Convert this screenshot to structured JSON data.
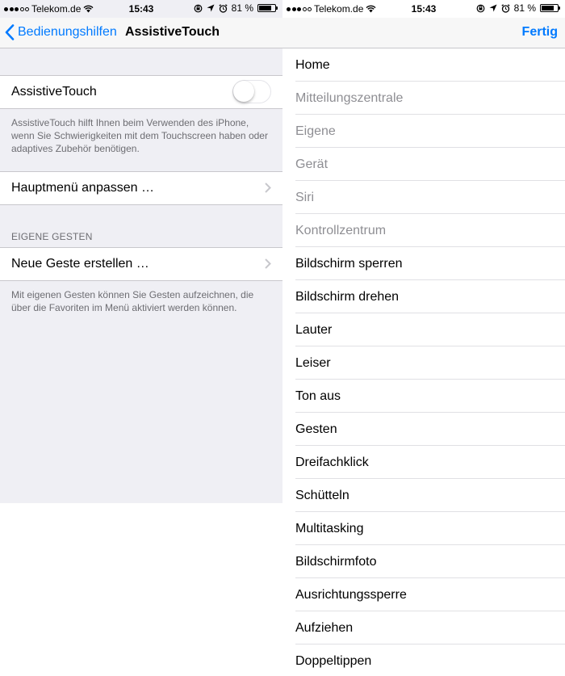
{
  "statusbar": {
    "carrier": "Telekom.de",
    "time": "15:43",
    "battery": "81 %",
    "battery_level": 0.81
  },
  "left": {
    "nav": {
      "back_label": "Bedienungshilfen",
      "title": "AssistiveTouch"
    },
    "assistive_touch": {
      "label": "AssistiveTouch",
      "enabled": false
    },
    "description": "AssistiveTouch hilft Ihnen beim Verwenden des iPhone, wenn Sie Schwierigkeiten mit dem Touchscreen haben oder adaptives Zubehör benötigen.",
    "customize_menu": "Hauptmenü anpassen …",
    "section_header": "EIGENE GESTEN",
    "new_gesture": "Neue Geste erstellen …",
    "gesture_footer": "Mit eigenen Gesten können Sie Gesten aufzeichnen, die über die Favoriten im Menü aktiviert werden können."
  },
  "right": {
    "done_label": "Fertig",
    "items": [
      {
        "label": "Home",
        "enabled": true
      },
      {
        "label": "Mitteilungszentrale",
        "enabled": false
      },
      {
        "label": "Eigene",
        "enabled": false
      },
      {
        "label": "Gerät",
        "enabled": false
      },
      {
        "label": "Siri",
        "enabled": false
      },
      {
        "label": "Kontrollzentrum",
        "enabled": false
      },
      {
        "label": "Bildschirm sperren",
        "enabled": true
      },
      {
        "label": "Bildschirm drehen",
        "enabled": true
      },
      {
        "label": "Lauter",
        "enabled": true
      },
      {
        "label": "Leiser",
        "enabled": true
      },
      {
        "label": "Ton aus",
        "enabled": true
      },
      {
        "label": "Gesten",
        "enabled": true
      },
      {
        "label": "Dreifachklick",
        "enabled": true
      },
      {
        "label": "Schütteln",
        "enabled": true
      },
      {
        "label": "Multitasking",
        "enabled": true
      },
      {
        "label": "Bildschirmfoto",
        "enabled": true
      },
      {
        "label": "Ausrichtungssperre",
        "enabled": true
      },
      {
        "label": "Aufziehen",
        "enabled": true
      },
      {
        "label": "Doppeltippen",
        "enabled": true
      }
    ]
  },
  "colors": {
    "accent": "#007aff",
    "grouped_background": "#efeff4",
    "disabled_text": "#8e8e93",
    "secondary_text": "#6d6d72"
  }
}
